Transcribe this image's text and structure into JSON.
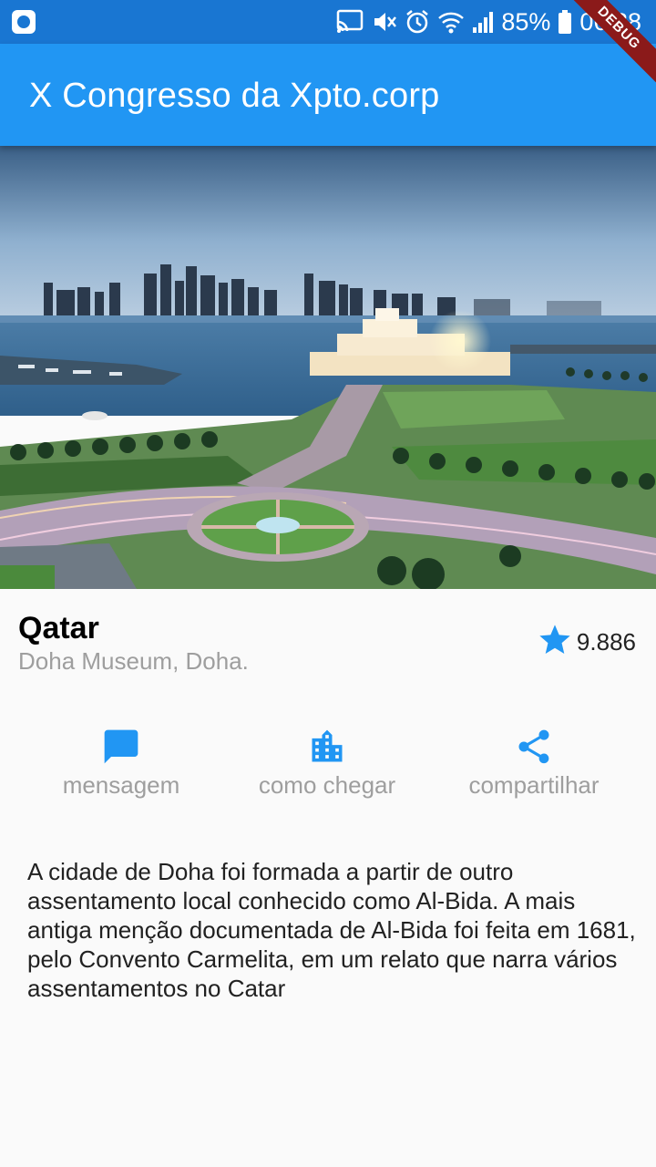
{
  "status_bar": {
    "battery": "85%",
    "time": "06:38",
    "icons": [
      "app-notification-icon",
      "cast-icon",
      "mute-icon",
      "alarm-icon",
      "wifi-icon",
      "signal-icon",
      "battery-icon"
    ]
  },
  "app_bar": {
    "title": "X Congresso da Xpto.corp",
    "debug_banner": "DEBUG"
  },
  "colors": {
    "primary": "#2196f3",
    "status_bar": "#1976d2",
    "icon_blue": "#2196f3",
    "muted_text": "#9e9e9e"
  },
  "place": {
    "title": "Qatar",
    "subtitle": "Doha Museum, Doha.",
    "rating": "9.886"
  },
  "actions": [
    {
      "label": "mensagem",
      "icon": "message-icon"
    },
    {
      "label": "como chegar",
      "icon": "location-city-icon"
    },
    {
      "label": "compartilhar",
      "icon": "share-icon"
    }
  ],
  "description": "A cidade de Doha foi formada a partir de outro assentamento local conhecido como Al-Bida. A mais antiga menção documentada de Al-Bida foi feita em 1681, pelo Convento Carmelita, em um relato que narra vários assentamentos no Catar"
}
